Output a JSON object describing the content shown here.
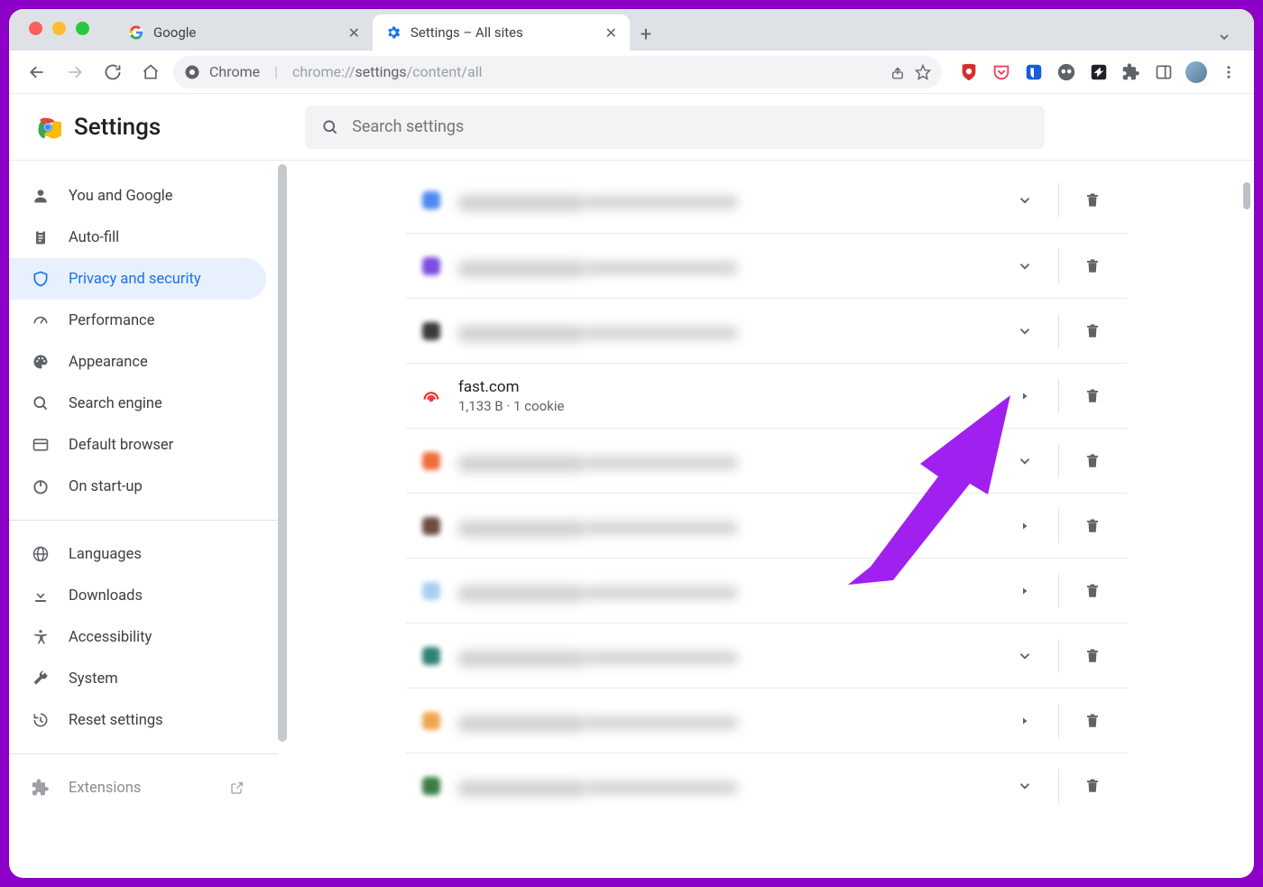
{
  "colors": {
    "frame": "#8d00c8",
    "accent": "#1a73e8",
    "arrow": "#a020f0",
    "traffic_red": "#ff5f57",
    "traffic_yellow": "#febc2e",
    "traffic_green": "#28c840"
  },
  "tabs": {
    "items": [
      {
        "label": "Google",
        "active": false
      },
      {
        "label": "Settings – All sites",
        "active": true
      }
    ],
    "new_tab": "+"
  },
  "omnibox": {
    "scheme_label": "Chrome",
    "url_prefix": "chrome://",
    "url_bold": "settings",
    "url_tail": "/content/all"
  },
  "settings": {
    "title": "Settings",
    "search_placeholder": "Search settings"
  },
  "sidebar": {
    "items": [
      {
        "icon": "user",
        "label": "You and Google"
      },
      {
        "icon": "clipboard",
        "label": "Auto-fill"
      },
      {
        "icon": "shield",
        "label": "Privacy and security",
        "active": true
      },
      {
        "icon": "gauge",
        "label": "Performance"
      },
      {
        "icon": "palette",
        "label": "Appearance"
      },
      {
        "icon": "search",
        "label": "Search engine"
      },
      {
        "icon": "browser",
        "label": "Default browser"
      },
      {
        "icon": "power",
        "label": "On start-up"
      }
    ],
    "items2": [
      {
        "icon": "globe",
        "label": "Languages"
      },
      {
        "icon": "download",
        "label": "Downloads"
      },
      {
        "icon": "accessibility",
        "label": "Accessibility"
      },
      {
        "icon": "wrench",
        "label": "System"
      },
      {
        "icon": "restore",
        "label": "Reset settings"
      }
    ],
    "items3": [
      {
        "icon": "extension",
        "label": "Extensions",
        "external": true
      }
    ]
  },
  "sites": {
    "rows": [
      {
        "blurred": true,
        "fav_color": "#4d8af0",
        "expand": "chevron",
        "name": "████",
        "sub": "████"
      },
      {
        "blurred": true,
        "fav_color": "#7b4de0",
        "expand": "chevron",
        "name": "████",
        "sub": "████"
      },
      {
        "blurred": true,
        "fav_color": "#3a3a3a",
        "expand": "chevron",
        "name": "████",
        "sub": "████"
      },
      {
        "blurred": false,
        "fav_color": "#e53935",
        "fav_ring": true,
        "expand": "caret",
        "name": "fast.com",
        "sub": "1,133 B · 1 cookie"
      },
      {
        "blurred": true,
        "fav_color": "#ef6c3d",
        "expand": "chevron",
        "name": "████",
        "sub": "████"
      },
      {
        "blurred": true,
        "fav_color": "#6d4c41",
        "expand": "caret",
        "name": "████",
        "sub": "████"
      },
      {
        "blurred": true,
        "fav_color": "#a6d0f2",
        "expand": "caret",
        "name": "████",
        "sub": "████"
      },
      {
        "blurred": true,
        "fav_color": "#2e8374",
        "expand": "chevron",
        "name": "████",
        "sub": "████"
      },
      {
        "blurred": true,
        "fav_color": "#f0a64f",
        "expand": "caret",
        "name": "████",
        "sub": "████"
      },
      {
        "blurred": true,
        "fav_color": "#3a7d44",
        "expand": "chevron",
        "name": "████",
        "sub": "████"
      }
    ]
  }
}
